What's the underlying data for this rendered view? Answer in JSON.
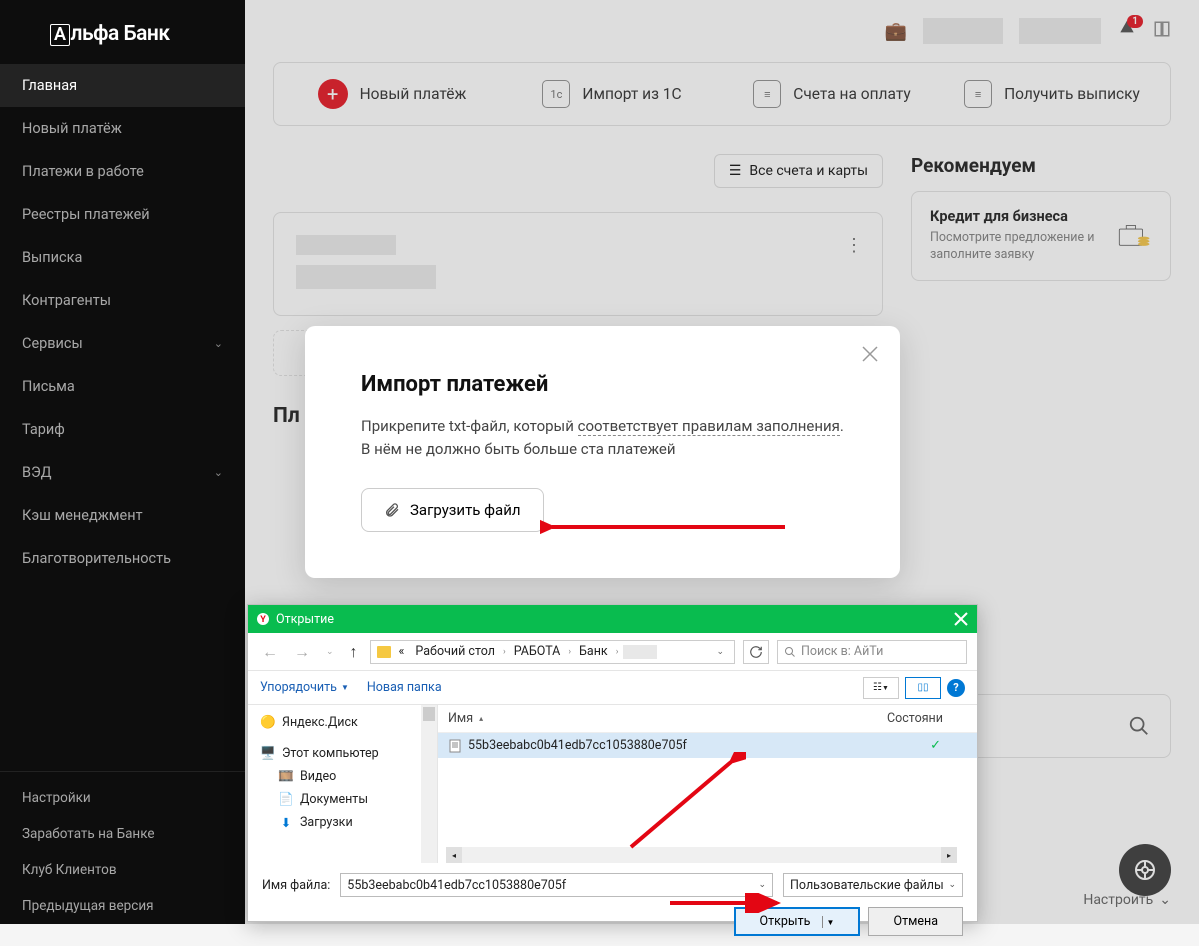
{
  "logo": "Альфа Банк",
  "sidebar": {
    "items": [
      {
        "label": "Главная",
        "active": true
      },
      {
        "label": "Новый платёж"
      },
      {
        "label": "Платежи в работе"
      },
      {
        "label": "Реестры платежей"
      },
      {
        "label": "Выписка"
      },
      {
        "label": "Контрагенты"
      },
      {
        "label": "Сервисы",
        "expandable": true
      },
      {
        "label": "Письма"
      },
      {
        "label": "Тариф"
      },
      {
        "label": "ВЭД",
        "expandable": true
      },
      {
        "label": "Кэш менеджмент"
      },
      {
        "label": "Благотворительность"
      }
    ],
    "bottom": [
      {
        "label": "Настройки"
      },
      {
        "label": "Заработать на Банке"
      },
      {
        "label": "Клуб Клиентов"
      },
      {
        "label": "Предыдущая версия"
      }
    ]
  },
  "header": {
    "notification_count": "1"
  },
  "actions": [
    {
      "label": "Новый платёж",
      "icon": "plus"
    },
    {
      "label": "Импорт из 1С",
      "icon": "1c"
    },
    {
      "label": "Счета на оплату",
      "icon": "doc"
    },
    {
      "label": "Получить выписку",
      "icon": "doc"
    }
  ],
  "accounts_btn": "Все счета и карты",
  "section_title_hidden": "Пл",
  "recommend": {
    "title": "Рекомендуем",
    "card": {
      "heading": "Кредит для бизнеса",
      "text": "Посмотрите предложение и заполните заявку"
    }
  },
  "settings_dd": "Настроить",
  "modal": {
    "title": "Импорт платежей",
    "text1": "Прикрепите txt-файл, который ",
    "link": "соответствует правилам заполнения",
    "text2": ". В нём не должно быть больше ста платежей",
    "upload": "Загрузить файл"
  },
  "file_dialog": {
    "title": "Открытие",
    "breadcrumb": [
      "Рабочий стол",
      "РАБОТА",
      "Банк",
      ""
    ],
    "search_placeholder": "Поиск в: АйТи",
    "toolbar": {
      "organize": "Упорядочить",
      "new_folder": "Новая папка"
    },
    "tree": [
      {
        "label": "Яндекс.Диск",
        "icon": "yadisk"
      },
      {
        "label": "Этот компьютер",
        "icon": "pc"
      },
      {
        "label": "Видео",
        "icon": "video",
        "indent": true
      },
      {
        "label": "Документы",
        "icon": "docs",
        "indent": true
      },
      {
        "label": "Загрузки",
        "icon": "downloads",
        "indent": true
      }
    ],
    "columns": {
      "name": "Имя",
      "status": "Состояни"
    },
    "file": "55b3eebabc0b41edb7cc1053880e705f",
    "filename_label": "Имя файла:",
    "filename_value": "55b3eebabc0b41edb7cc1053880e705f",
    "filter": "Пользовательские файлы",
    "open": "Открыть",
    "cancel": "Отмена"
  }
}
